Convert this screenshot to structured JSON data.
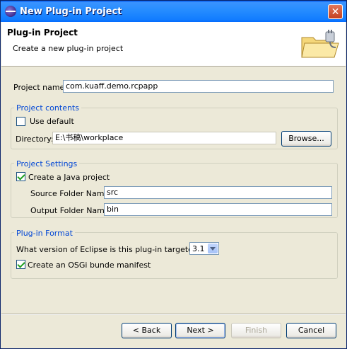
{
  "window": {
    "title": "New Plug-in Project",
    "close_glyph": "✕"
  },
  "banner": {
    "title": "Plug-in Project",
    "description": "Create a new plug-in project"
  },
  "project_name": {
    "label": "Project name",
    "value": "com.kuaff.demo.rcpapp"
  },
  "project_contents": {
    "title": "Project contents",
    "use_default_label": "Use default",
    "use_default_checked": false,
    "directory_label": "Directory:",
    "directory_value": "E:\\书稿\\workplace",
    "browse_label": "Browse..."
  },
  "project_settings": {
    "title": "Project Settings",
    "java_project_label": "Create a Java project",
    "java_project_checked": true,
    "source_label": "Source Folder Name:",
    "source_value": "src",
    "output_label": "Output Folder Name:",
    "output_value": "bin"
  },
  "plugin_format": {
    "title": "Plug-in Format",
    "version_label": "What version of Eclipse is this plug-in targeted for?",
    "version_value": "3.1",
    "osgi_label": "Create an OSGi bunde manifest",
    "osgi_checked": true
  },
  "buttons": {
    "back": "< Back",
    "next": "Next >",
    "finish": "Finish",
    "cancel": "Cancel"
  },
  "colors": {
    "title_bar": "#0058ee",
    "group_title": "#0046d5",
    "dialog_bg": "#ece9d8"
  },
  "icons": {
    "title": "eclipse-icon",
    "banner": "folder-plugin-icon"
  }
}
